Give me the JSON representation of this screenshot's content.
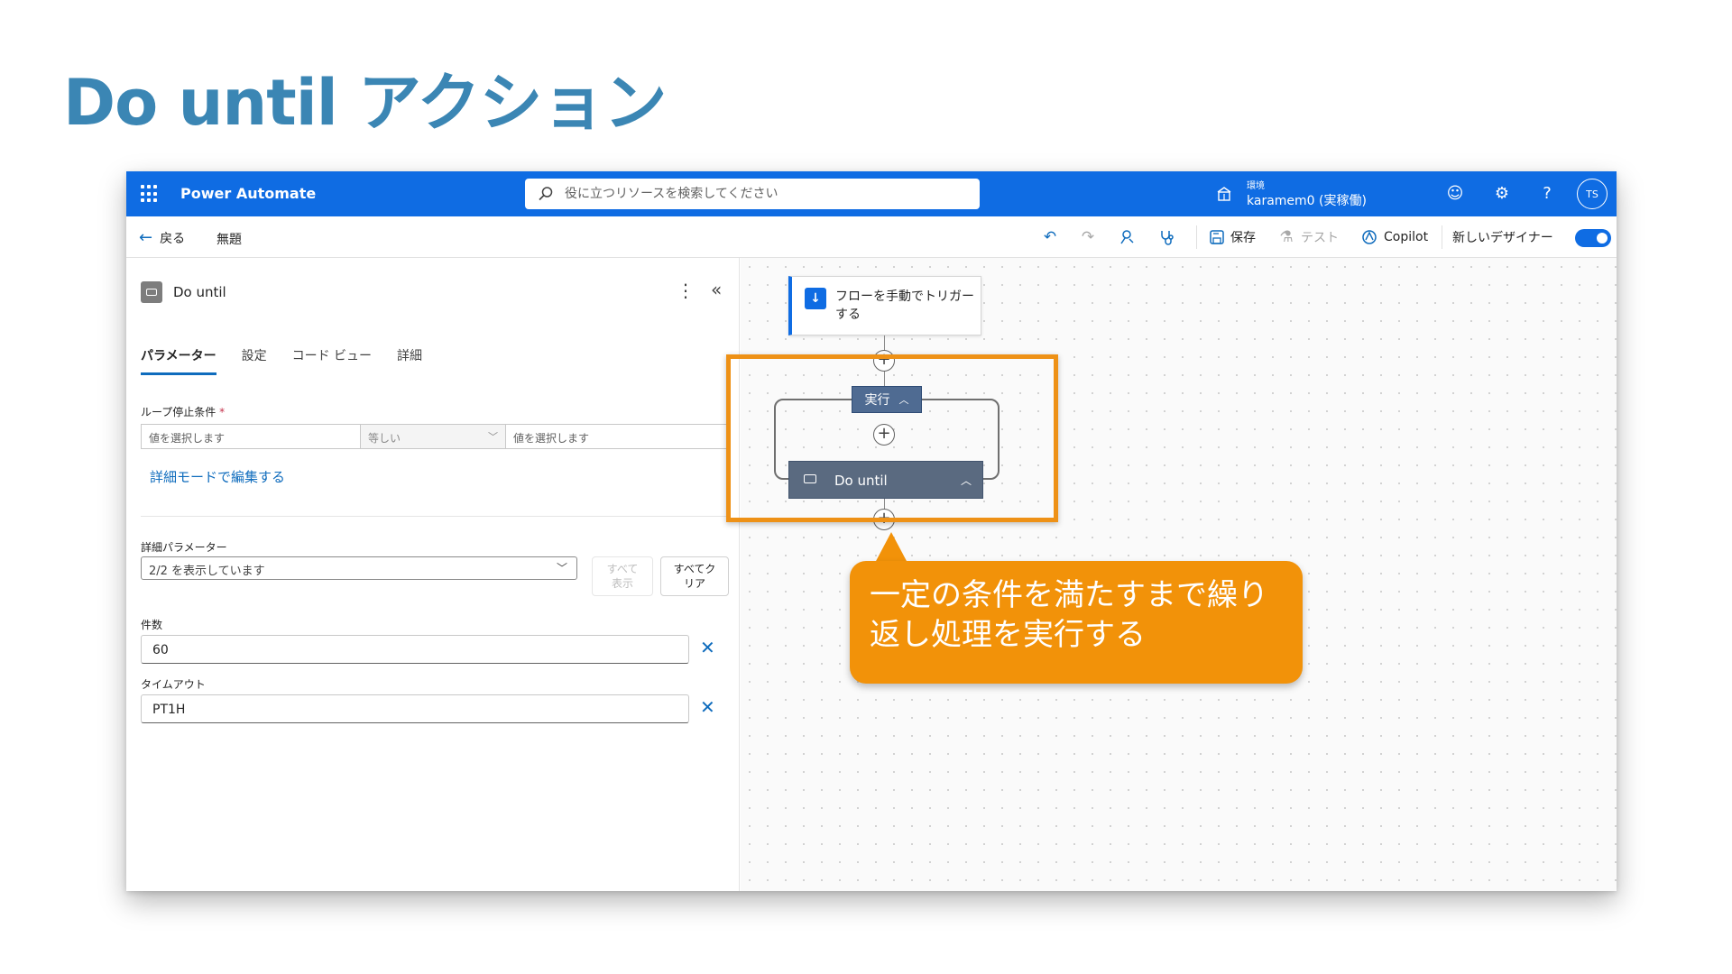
{
  "slide": {
    "title": "Do until アクション"
  },
  "header": {
    "app_name": "Power Automate",
    "search_placeholder": "役に立つリソースを検索してください",
    "environment_label": "環境",
    "environment_value": "karamem0 (実稼働)",
    "avatar_initials": "TS",
    "brand_color": "#0F6CE3"
  },
  "toolbar": {
    "back_label": "戻る",
    "flow_name": "無題",
    "save_label": "保存",
    "test_label": "テスト",
    "copilot_label": "Copilot",
    "new_designer_label": "新しいデザイナー",
    "new_designer_enabled": true
  },
  "panel": {
    "title": "Do until",
    "tabs": [
      "パラメーター",
      "設定",
      "コード ビュー",
      "詳細"
    ],
    "active_tab": "パラメーター",
    "loop_condition_label": "ループ停止条件",
    "required_mark": "*",
    "condition_left_placeholder": "値を選択します",
    "condition_operator": "等しい",
    "condition_right_placeholder": "値を選択します",
    "advanced_edit_link": "詳細モードで編集する",
    "advanced_params_label": "詳細パラメーター",
    "advanced_params_value": "2/2 を表示しています",
    "show_all_label": "すべて\n表示",
    "clear_all_label": "すべてク\nリア",
    "count_label": "件数",
    "count_value": "60",
    "timeout_label": "タイムアウト",
    "timeout_value": "PT1H"
  },
  "canvas": {
    "trigger_label": "フローを手動でトリガーする",
    "run_chip_label": "実行",
    "loop_action_label": "Do until"
  },
  "callout": {
    "text": "一定の条件を満たすまで繰り返し処理を実行する",
    "color": "#F29209"
  },
  "icons": {
    "waffle": "waffle-icon",
    "search": "search-icon",
    "environment": "environment-icon",
    "feedback": "smiley-icon",
    "settings": "gear-icon",
    "help": "help-icon",
    "undo": "undo-icon",
    "redo": "redo-icon",
    "flow_checker": "flow-checker-icon",
    "save": "save-icon",
    "test": "flask-icon",
    "copilot": "copilot-icon"
  }
}
